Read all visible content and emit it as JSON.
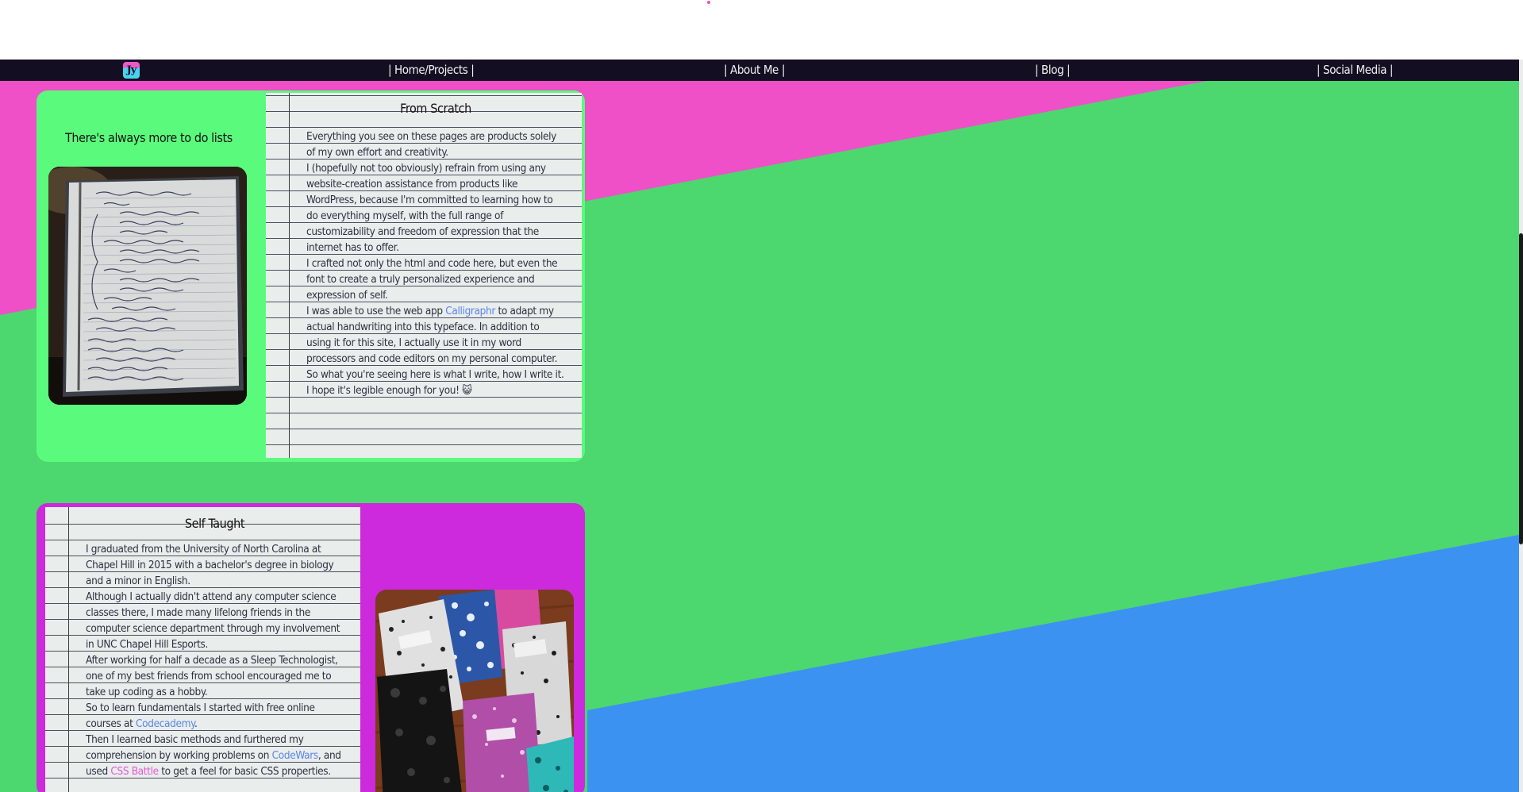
{
  "nav": {
    "logo_text": "Jy",
    "items": [
      {
        "label": "| Home/Projects |"
      },
      {
        "label": "| About Me |"
      },
      {
        "label": "| Blog |"
      },
      {
        "label": "| Social Media |"
      }
    ]
  },
  "card1": {
    "caption": "There's always more to do lists",
    "paper_title": "From Scratch",
    "paragraphs": [
      "Everything you see on these pages are products solely of my own effort and creativity.",
      "I (hopefully not too obviously) refrain from using any website-creation assistance from products like WordPress, because I'm committed to learning how to do everything myself, with the full range of customizability and freedom of expression that the internet has to offer.",
      "I crafted not only the html and code here, but even the font to create a truly personalized experience and expression of self."
    ],
    "p4_before": "I was able to use the web app ",
    "p4_link": "Calligraphr",
    "p4_after": " to adapt my actual handwriting into this typeface. In addition to using it for this site, I actually use it in my word processors and code editors on my personal computer.",
    "p5": "So what you're seeing here is what I write, how I write it.",
    "p6": "I hope it's legible enough for you! 😺"
  },
  "card2": {
    "paper_title": "Self Taught",
    "p1": "I graduated from the University of North Carolina at Chapel Hill in 2015 with a bachelor's degree in biology and a minor in English.",
    "p2": "Although I actually didn't attend any computer science classes there, I made many lifelong friends in the computer science department through my involvement in UNC Chapel Hill Esports.",
    "p3": "After working for half a decade as a Sleep Technologist, one of my best friends from school encouraged me to take up coding as a hobby.",
    "p4_before": "So to learn fundamentals I started with free online courses at ",
    "p4_link": "Codecademy",
    "p4_after": ".",
    "p5_before": "Then I learned basic methods and furthered my comprehension by working problems on ",
    "p5_link1": "CodeWars",
    "p5_mid": ", and used ",
    "p5_link2": "CSS Battle",
    "p5_after": " to get a feel for basic CSS properties."
  },
  "colors": {
    "pink": "#ef50c8",
    "green": "#4dd76f",
    "blue": "#3c92f0",
    "card_green": "#5afb7c",
    "card_purple": "#cd29dd",
    "navbar": "#130e22",
    "link_blue": "#5a86e6",
    "link_pink": "#e35ad0"
  },
  "icons": [
    "logo-icon",
    "notebook-photo-icon",
    "composition-notebooks-photo-icon",
    "cat-emoji-icon"
  ]
}
